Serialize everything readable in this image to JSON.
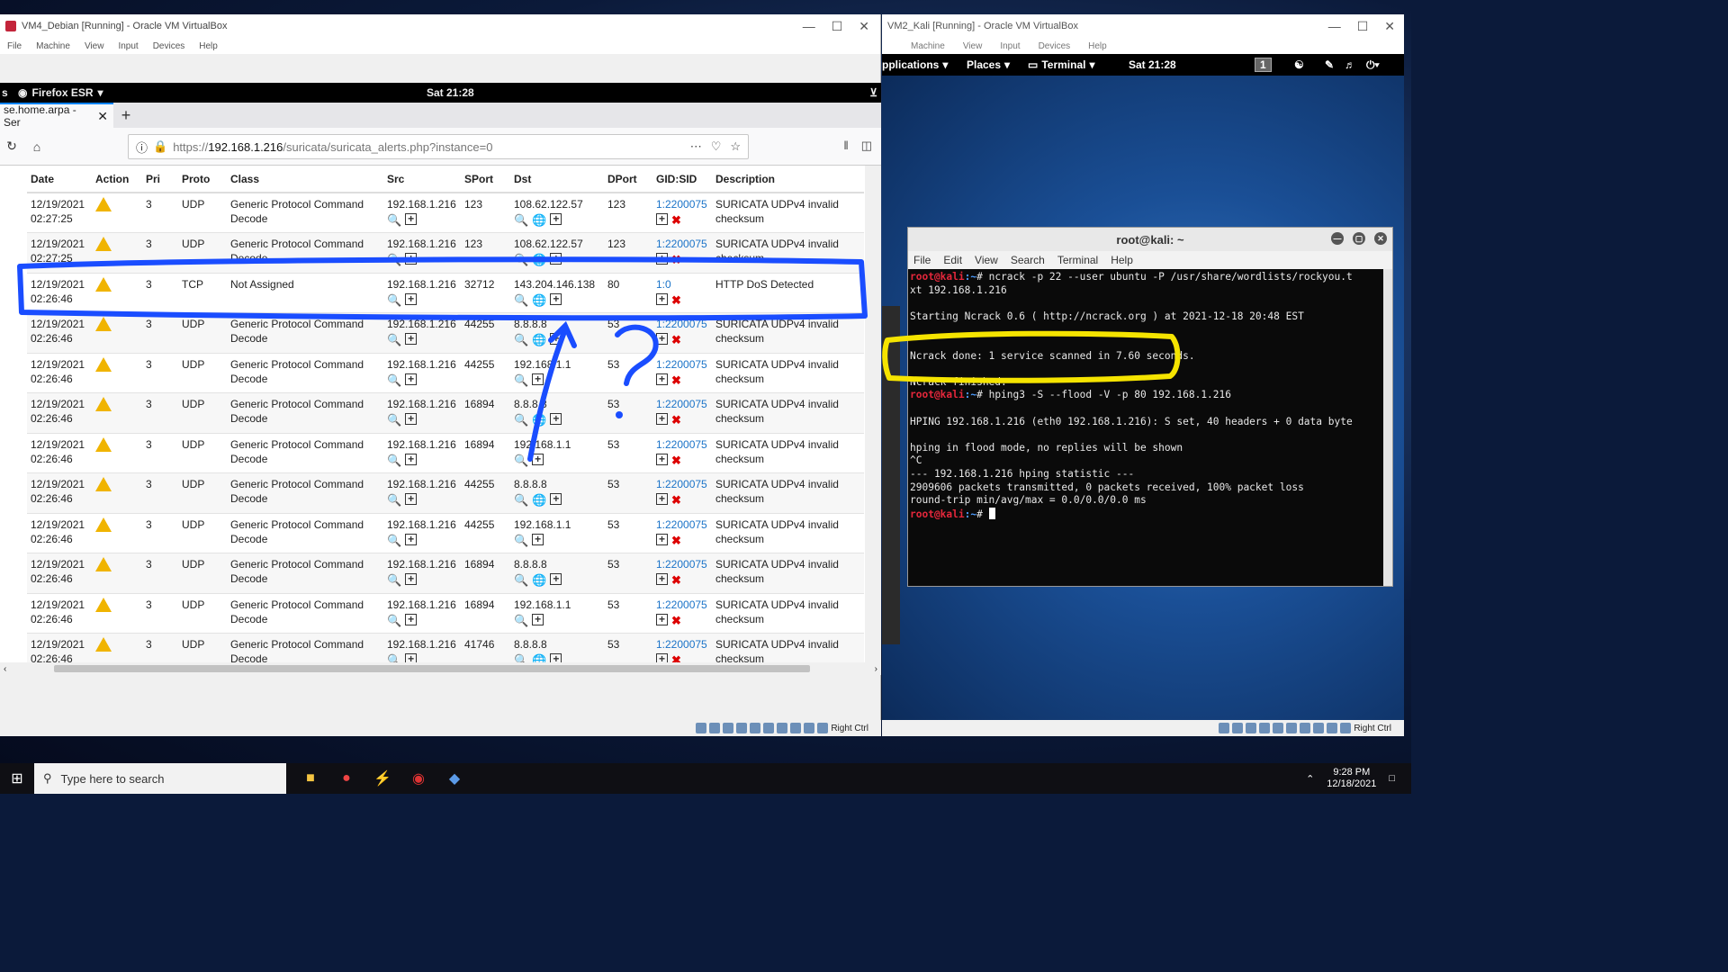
{
  "left_window": {
    "title": "VM4_Debian [Running] - Oracle VM VirtualBox",
    "menu": [
      "File",
      "Machine",
      "View",
      "Input",
      "Devices",
      "Help"
    ],
    "gnome": {
      "activities": "s",
      "app": "Firefox ESR",
      "clock": "Sat 21:28"
    },
    "tab": {
      "label": "se.home.arpa - Ser"
    },
    "url": {
      "prefix": "https://",
      "domain": "192.168.1.216",
      "path": "/suricata/suricata_alerts.php?instance=0"
    },
    "table": {
      "headers": [
        "Date",
        "Action",
        "Pri",
        "Proto",
        "Class",
        "Src",
        "SPort",
        "Dst",
        "DPort",
        "GID:SID",
        "Description"
      ],
      "rows": [
        {
          "date": "12/19/2021",
          "time": "02:27:25",
          "pri": "3",
          "proto": "UDP",
          "class": "Generic Protocol Command",
          "class2": "Decode",
          "src": "192.168.1.216",
          "sport": "123",
          "dst": "108.62.122.57",
          "dport": "123",
          "sid": "1:2200075",
          "desc": "SURICATA UDPv4 invalid",
          "desc2": "checksum"
        },
        {
          "date": "12/19/2021",
          "time": "02:27:25",
          "pri": "3",
          "proto": "UDP",
          "class": "Generic Protocol Command",
          "class2": "Decode",
          "src": "192.168.1.216",
          "sport": "123",
          "dst": "108.62.122.57",
          "dport": "123",
          "sid": "1:2200075",
          "desc": "SURICATA UDPv4 invalid",
          "desc2": "checksum"
        },
        {
          "date": "12/19/2021",
          "time": "02:26:46",
          "pri": "3",
          "proto": "TCP",
          "class": "Not Assigned",
          "class2": "",
          "src": "192.168.1.216",
          "sport": "32712",
          "dst": "143.204.146.138",
          "dport": "80",
          "sid": "1:0",
          "desc": "HTTP DoS Detected",
          "desc2": ""
        },
        {
          "date": "12/19/2021",
          "time": "02:26:46",
          "pri": "3",
          "proto": "UDP",
          "class": "Generic Protocol Command",
          "class2": "Decode",
          "src": "192.168.1.216",
          "sport": "44255",
          "dst": "8.8.8.8",
          "dport": "53",
          "sid": "1:2200075",
          "desc": "SURICATA UDPv4 invalid",
          "desc2": "checksum"
        },
        {
          "date": "12/19/2021",
          "time": "02:26:46",
          "pri": "3",
          "proto": "UDP",
          "class": "Generic Protocol Command",
          "class2": "Decode",
          "src": "192.168.1.216",
          "sport": "44255",
          "dst": "192.168.1.1",
          "dport": "53",
          "sid": "1:2200075",
          "desc": "SURICATA UDPv4 invalid",
          "desc2": "checksum"
        },
        {
          "date": "12/19/2021",
          "time": "02:26:46",
          "pri": "3",
          "proto": "UDP",
          "class": "Generic Protocol Command",
          "class2": "Decode",
          "src": "192.168.1.216",
          "sport": "16894",
          "dst": "8.8.8.8",
          "dport": "53",
          "sid": "1:2200075",
          "desc": "SURICATA UDPv4 invalid",
          "desc2": "checksum"
        },
        {
          "date": "12/19/2021",
          "time": "02:26:46",
          "pri": "3",
          "proto": "UDP",
          "class": "Generic Protocol Command",
          "class2": "Decode",
          "src": "192.168.1.216",
          "sport": "16894",
          "dst": "192.168.1.1",
          "dport": "53",
          "sid": "1:2200075",
          "desc": "SURICATA UDPv4 invalid",
          "desc2": "checksum"
        },
        {
          "date": "12/19/2021",
          "time": "02:26:46",
          "pri": "3",
          "proto": "UDP",
          "class": "Generic Protocol Command",
          "class2": "Decode",
          "src": "192.168.1.216",
          "sport": "44255",
          "dst": "8.8.8.8",
          "dport": "53",
          "sid": "1:2200075",
          "desc": "SURICATA UDPv4 invalid",
          "desc2": "checksum"
        },
        {
          "date": "12/19/2021",
          "time": "02:26:46",
          "pri": "3",
          "proto": "UDP",
          "class": "Generic Protocol Command",
          "class2": "Decode",
          "src": "192.168.1.216",
          "sport": "44255",
          "dst": "192.168.1.1",
          "dport": "53",
          "sid": "1:2200075",
          "desc": "SURICATA UDPv4 invalid",
          "desc2": "checksum"
        },
        {
          "date": "12/19/2021",
          "time": "02:26:46",
          "pri": "3",
          "proto": "UDP",
          "class": "Generic Protocol Command",
          "class2": "Decode",
          "src": "192.168.1.216",
          "sport": "16894",
          "dst": "8.8.8.8",
          "dport": "53",
          "sid": "1:2200075",
          "desc": "SURICATA UDPv4 invalid",
          "desc2": "checksum"
        },
        {
          "date": "12/19/2021",
          "time": "02:26:46",
          "pri": "3",
          "proto": "UDP",
          "class": "Generic Protocol Command",
          "class2": "Decode",
          "src": "192.168.1.216",
          "sport": "16894",
          "dst": "192.168.1.1",
          "dport": "53",
          "sid": "1:2200075",
          "desc": "SURICATA UDPv4 invalid",
          "desc2": "checksum"
        },
        {
          "date": "12/19/2021",
          "time": "02:26:46",
          "pri": "3",
          "proto": "UDP",
          "class": "Generic Protocol Command",
          "class2": "Decode",
          "src": "192.168.1.216",
          "sport": "41746",
          "dst": "8.8.8.8",
          "dport": "53",
          "sid": "1:2200075",
          "desc": "SURICATA UDPv4 invalid",
          "desc2": "checksum"
        }
      ]
    },
    "status_key": "Right Ctrl"
  },
  "right_window": {
    "title": "VM2_Kali [Running] - Oracle VM VirtualBox",
    "menu": [
      "Machine",
      "View",
      "Input",
      "Devices",
      "Help"
    ],
    "panel": {
      "applications": "pplications",
      "places": "Places",
      "terminal": "Terminal",
      "clock": "Sat 21:28",
      "workspace": "1"
    },
    "terminal": {
      "title": "root@kali: ~",
      "menu": [
        "File",
        "Edit",
        "View",
        "Search",
        "Terminal",
        "Help"
      ],
      "prompt_user": "root@kali",
      "prompt_path": ":~",
      "lines": {
        "cmd1": "# ncrack -p 22 --user ubuntu -P /usr/share/wordlists/rockyou.t",
        "cmd1b": "xt 192.168.1.216",
        "starting": "Starting Ncrack 0.6 ( http://ncrack.org ) at 2021-12-18 20:48 EST",
        "done": "Ncrack done: 1 service scanned in 7.60 seconds.",
        "finished": "Ncrack finished.",
        "cmd2": "# hping3 -S --flood -V -p 80 192.168.1.216",
        "hping": "HPING 192.168.1.216 (eth0 192.168.1.216): S set, 40 headers + 0 data byte",
        "flood": "hping in flood mode, no replies will be shown",
        "ctrlc": "^C",
        "stat": "--- 192.168.1.216 hping statistic ---",
        "tx": "2909606 packets transmitted, 0 packets received, 100% packet loss",
        "rtt": "round-trip min/avg/max = 0.0/0.0/0.0 ms",
        "cmd3": "# "
      }
    },
    "status_key": "Right Ctrl"
  },
  "taskbar": {
    "search_placeholder": "Type here to search",
    "time": "9:28 PM",
    "date": "12/18/2021"
  }
}
